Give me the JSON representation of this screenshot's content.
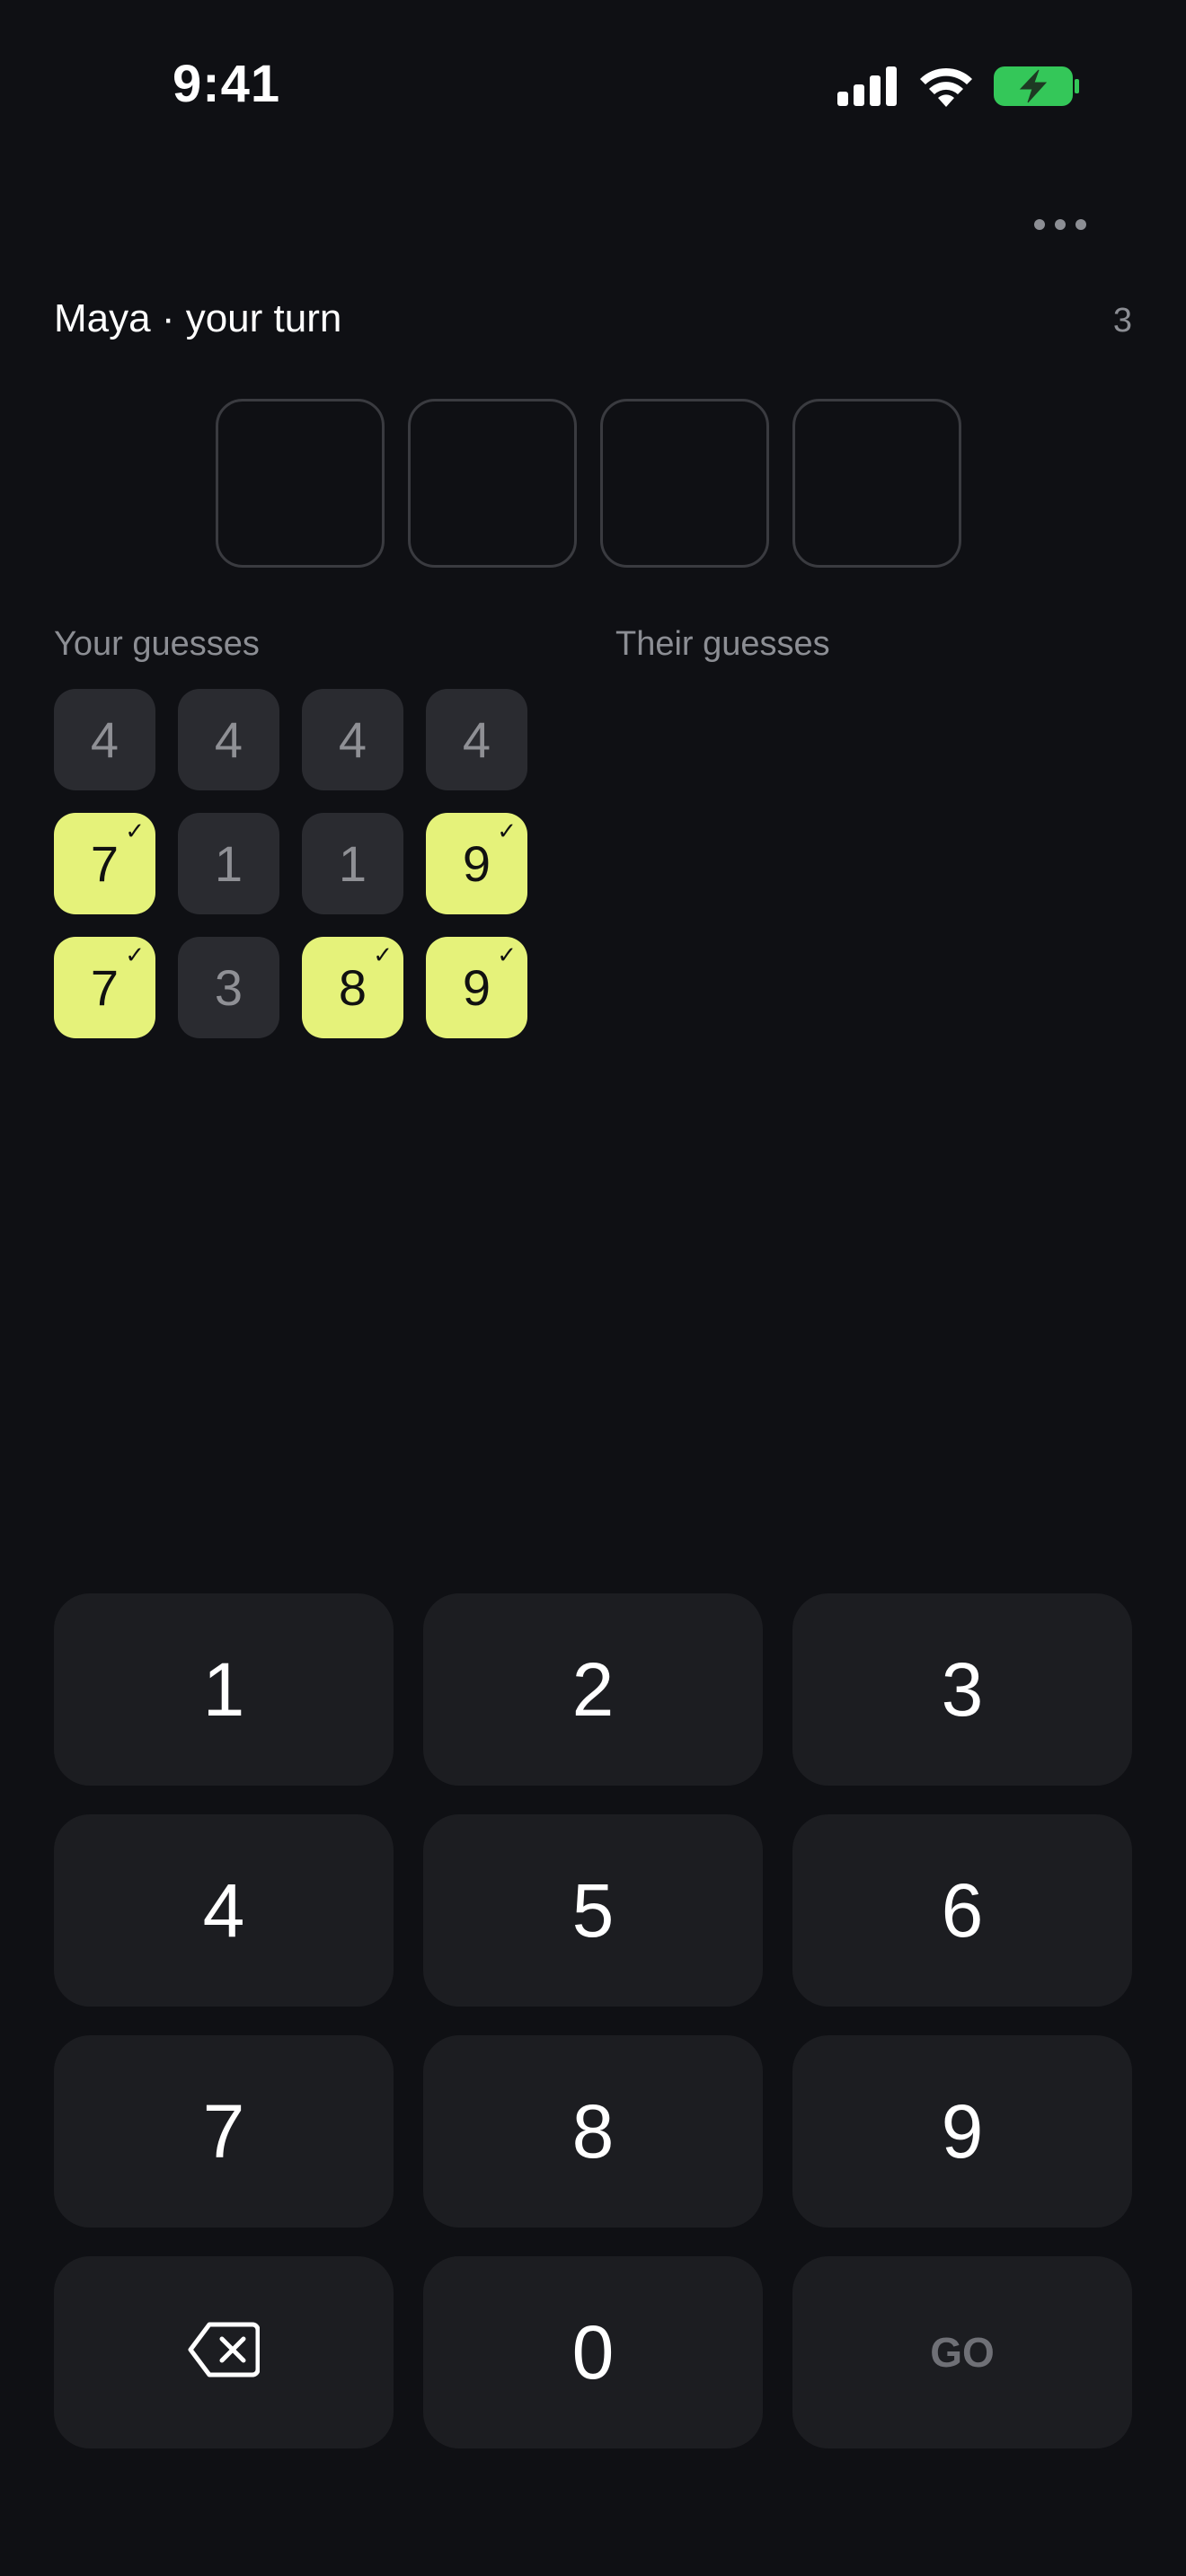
{
  "status_bar": {
    "time": "9:41",
    "battery_color": "#34c759"
  },
  "header": {
    "player_label": "Maya · your turn",
    "round_count": "3",
    "more_icon": "ellipsis-icon"
  },
  "input": {
    "slots": [
      "",
      "",
      "",
      ""
    ]
  },
  "sections": {
    "your_guesses": "Your guesses",
    "their_guesses": "Their guesses"
  },
  "your_guesses": [
    [
      {
        "digit": "4",
        "correct": false
      },
      {
        "digit": "4",
        "correct": false
      },
      {
        "digit": "4",
        "correct": false
      },
      {
        "digit": "4",
        "correct": false
      }
    ],
    [
      {
        "digit": "7",
        "correct": true
      },
      {
        "digit": "1",
        "correct": false
      },
      {
        "digit": "1",
        "correct": false
      },
      {
        "digit": "9",
        "correct": true
      }
    ],
    [
      {
        "digit": "7",
        "correct": true
      },
      {
        "digit": "3",
        "correct": false
      },
      {
        "digit": "8",
        "correct": true
      },
      {
        "digit": "9",
        "correct": true
      }
    ]
  ],
  "their_guesses": [],
  "keypad": {
    "keys": [
      "1",
      "2",
      "3",
      "4",
      "5",
      "6",
      "7",
      "8",
      "9"
    ],
    "zero": "0",
    "go_label": "GO",
    "backspace_icon": "backspace-icon"
  },
  "colors": {
    "background": "#0f1014",
    "hit_tile": "#e5f27a",
    "miss_tile": "#2a2b30",
    "key_bg": "#1c1d21"
  }
}
